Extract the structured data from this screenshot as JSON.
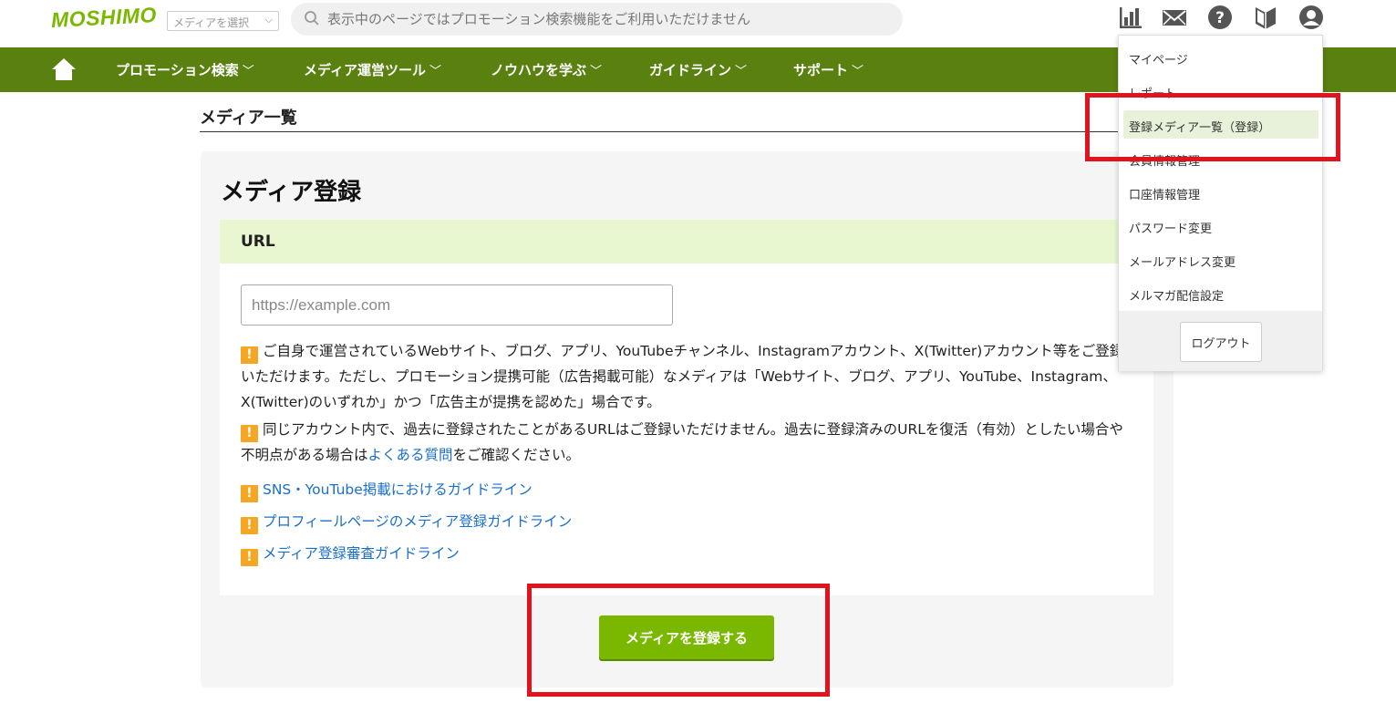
{
  "header": {
    "logo": "MOSHIMO",
    "media_select": "メディアを選択",
    "search_placeholder": "表示中のページではプロモーション検索機能をご利用いただけません",
    "icons": [
      "report-chart-icon",
      "mail-icon",
      "help-icon",
      "beginner-mark-icon",
      "user-account-icon"
    ]
  },
  "nav": {
    "items": [
      {
        "label": "プロモーション検索"
      },
      {
        "label": "メディア運営ツール"
      },
      {
        "label": "ノウハウを学ぶ"
      },
      {
        "label": "ガイドライン"
      },
      {
        "label": "サポート"
      }
    ],
    "chevron": "﹀"
  },
  "page": {
    "heading": "メディア一覧",
    "card_title": "メディア登録",
    "url_label": "URL",
    "url_placeholder": "https://example.com",
    "warn_glyph": "!",
    "note1": "ご自身で運営されているWebサイト、ブログ、アプリ、YouTubeチャンネル、Instagramアカウント、X(Twitter)アカウント等をご登録いただけます。ただし、プロモーション提携可能（広告掲載可能）なメディアは「Webサイト、ブログ、アプリ、YouTube、Instagram、X(Twitter)のいずれか」かつ「広告主が提携を認めた」場合です。",
    "note2_a": "同じアカウント内で、過去に登録されたことがあるURLはご登録いただけません。過去に登録済みのURLを復活（有効）としたい場合や不明点がある場合は",
    "note2_link": "よくある質問",
    "note2_b": "をご確認ください。",
    "links": [
      "SNS・YouTube掲載におけるガイドライン",
      "プロフィールページのメディア登録ガイドライン",
      "メディア登録審査ガイドライン"
    ],
    "submit_label": "メディアを登録する"
  },
  "dropdown": {
    "items": [
      "マイページ",
      "レポート",
      "登録メディア一覧（登録）",
      "会員情報管理",
      "口座情報管理",
      "パスワード変更",
      "メールアドレス変更",
      "メルマガ配信設定"
    ],
    "active_index": 2,
    "logout_label": "ログアウト"
  },
  "colors": {
    "brand_green": "#7ab800",
    "nav_green": "#5a8010",
    "highlight_red": "#e0141e",
    "link_blue": "#1a6fc9",
    "warn_orange": "#f5a623"
  }
}
